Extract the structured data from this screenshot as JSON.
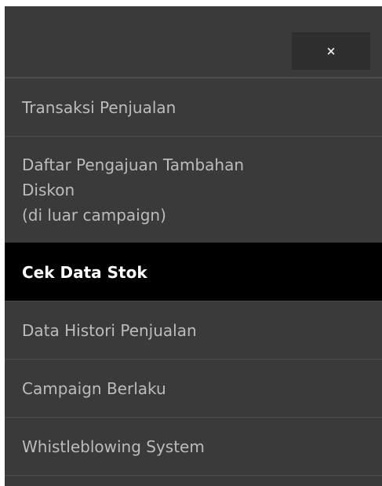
{
  "close_button": {
    "icon": "close-icon",
    "symbol": "×"
  },
  "menu": {
    "items": [
      {
        "label": "Transaksi Penjualan",
        "active": false
      },
      {
        "label": "Daftar Pengajuan Tambahan\nDiskon\n(di luar campaign)",
        "active": false
      },
      {
        "label": "Cek Data Stok",
        "active": true
      },
      {
        "label": "Data Histori Penjualan",
        "active": false
      },
      {
        "label": "Campaign Berlaku",
        "active": false
      },
      {
        "label": "Whistleblowing System",
        "active": false
      }
    ]
  },
  "colors": {
    "panel_background": "#3a3a3a",
    "active_background": "#000000",
    "text_default": "#bcbcbc",
    "text_active": "#ffffff"
  }
}
